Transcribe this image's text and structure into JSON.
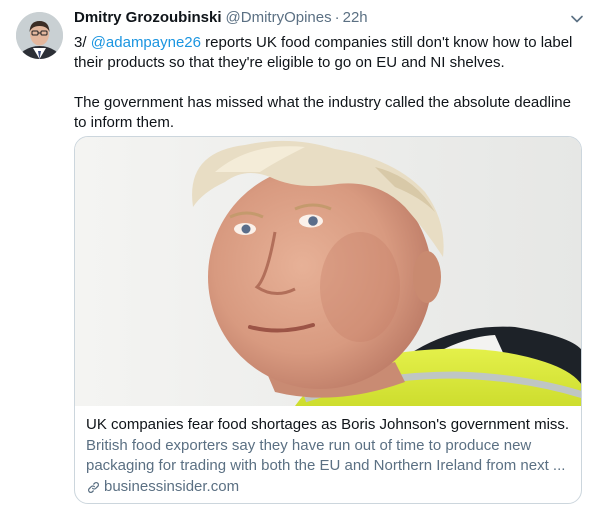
{
  "tweet": {
    "display_name": "Dmitry Grozoubinski",
    "handle": "@DmitryOpines",
    "separator": "·",
    "timestamp": "22h",
    "text": {
      "prefix": "3/ ",
      "mention": "@adampayne26",
      "line1_rest": " reports UK food companies still don't know how to label",
      "line2": "their products so that they're eligible to go on EU and NI shelves.",
      "para2_line1": "The government has missed what the industry called the absolute deadline",
      "para2_line2": "to inform them."
    }
  },
  "card": {
    "title": "UK companies fear food shortages as Boris Johnson's government miss...",
    "description_line1": "British food exporters say they have run out of time to produce new",
    "description_line2": "packaging for trading with both the EU and Northern Ireland from next ...",
    "domain": "businessinsider.com"
  },
  "icons": {
    "avatar": "avatar",
    "caret": "chevron-down-icon",
    "link": "link-icon"
  },
  "colors": {
    "mention": "#1b95e0",
    "secondary_text": "#5b7083",
    "border": "#ccd6dd"
  }
}
